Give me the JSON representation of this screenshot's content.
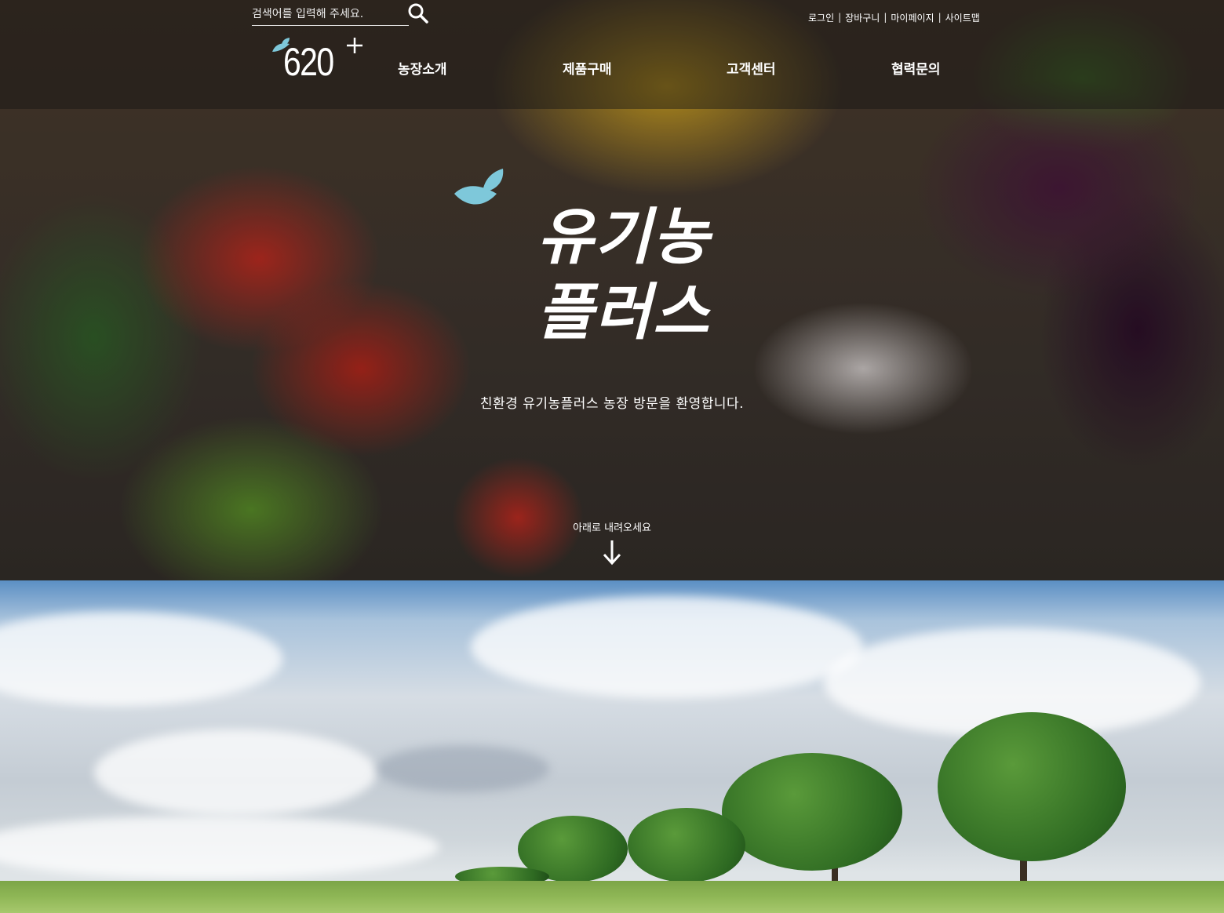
{
  "header": {
    "search": {
      "placeholder": "검색어를 입력해 주세요.",
      "value": ""
    },
    "util_links": [
      "로그인",
      "장바구니",
      "마이페이지",
      "사이트맵"
    ],
    "logo_text": "620",
    "nav": [
      "농장소개",
      "제품구매",
      "고객센터",
      "협력문의"
    ]
  },
  "hero": {
    "title": "유기농 플러스",
    "subtitle": "친환경 유기농플러스 농장 방문을 환영합니다.",
    "scroll_label": "아래로 내려오세요"
  },
  "colors": {
    "leaf_accent": "#7ec8da",
    "text": "#ffffff",
    "header_overlay": "rgba(20,20,20,0.45)"
  },
  "icons": [
    "search-icon",
    "leaf-icon",
    "plus-icon",
    "arrow-down-icon"
  ]
}
